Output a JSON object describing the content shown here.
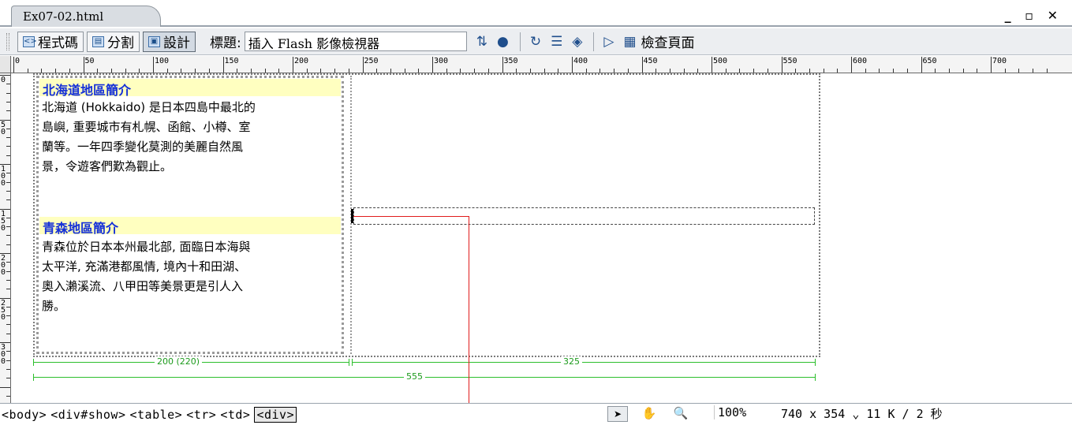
{
  "tab": {
    "filename": "Ex07-02.html",
    "window_controls": "_ ▫ ✕"
  },
  "toolbar": {
    "code_label": "程式碼",
    "split_label": "分割",
    "design_label": "設計",
    "title_label": "標題:",
    "title_value": "插入 Flash 影像檢視器",
    "check_page_label": "檢查頁面"
  },
  "ruler": {
    "h_labels": [
      "0",
      "50",
      "100",
      "150",
      "200",
      "250",
      "300",
      "350",
      "400",
      "450",
      "500",
      "550",
      "600",
      "650",
      "700"
    ],
    "v_labels": [
      "0",
      "5 0",
      "1 0 0",
      "1 5 0",
      "2 0 0",
      "2 5 0",
      "3 0 0"
    ]
  },
  "content": {
    "section1_title": "北海道地區簡介",
    "section1_lines": [
      "北海道 (Hokkaido) 是日本四島中最北的",
      "島嶼, 重要城市有札幌、函館、小樽、室",
      "蘭等。一年四季變化莫測的美麗自然風",
      "景，令遊客們歎為觀止。"
    ],
    "section2_title": "青森地區簡介",
    "section2_lines": [
      "青森位於日本本州最北部, 面臨日本海與",
      "太平洋, 充滿港都風情, 境內十和田湖、",
      "奧入瀨溪流、八甲田等美景更是引人入",
      "勝。"
    ]
  },
  "widths": {
    "left_col": "200 (220)",
    "right_col": "325",
    "total": "555"
  },
  "status": {
    "tags": [
      "<body>",
      "<div#show>",
      "<table>",
      "<tr>",
      "<td>",
      "<div>"
    ],
    "zoom": "100%",
    "dimensions": "740 x 354",
    "size_time": "11 K / 2 秒"
  },
  "colors": {
    "title_bg": "#ffffc0",
    "title_text": "#1530d8",
    "guide_green": "#2cbf2c",
    "pointer_red": "#e01c1c"
  }
}
